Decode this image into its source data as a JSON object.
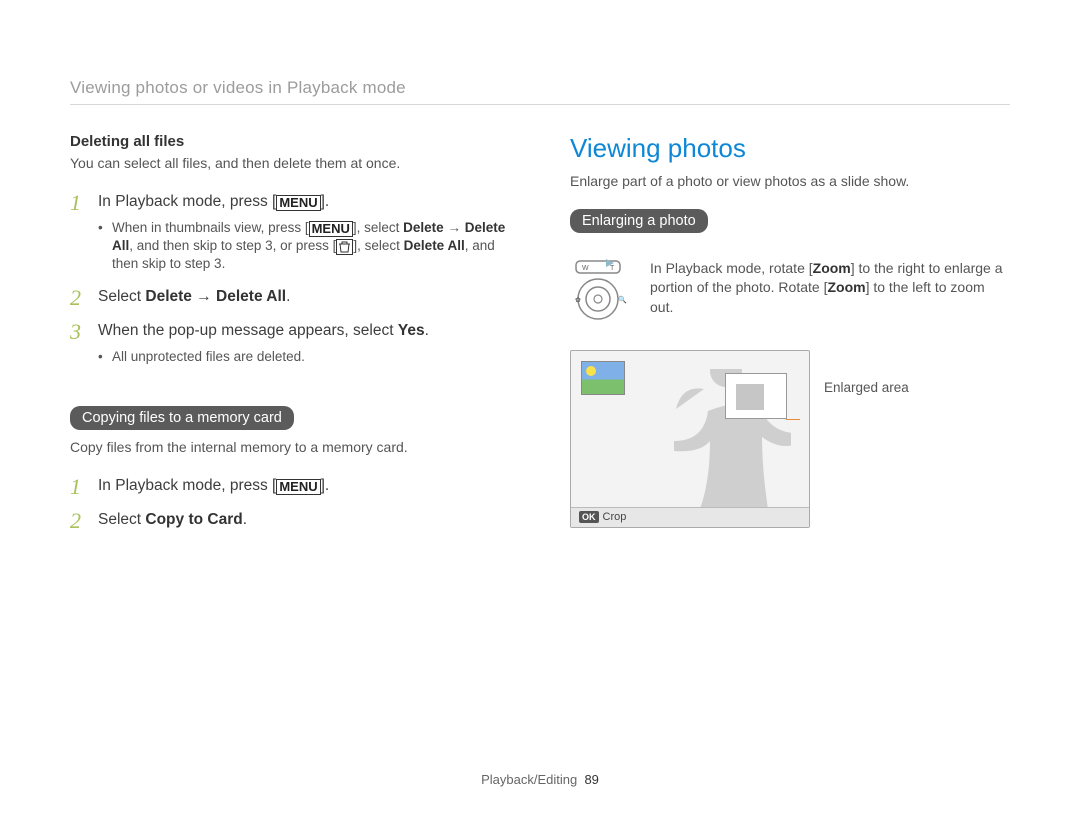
{
  "breadcrumb": "Viewing photos or videos in Playback mode",
  "left": {
    "subheading": "Deleting all files",
    "intro": "You can select all files, and then delete them at once.",
    "steps": [
      {
        "num": "1",
        "text_pre": "In Playback mode, press [",
        "icon": "MENU",
        "text_post": "].",
        "bullets": [
          {
            "pre": "When in thumbnails view, press [",
            "icon1": "MENU",
            "mid": "], select ",
            "b1": "Delete",
            "arrow": " → ",
            "b2": "Delete All",
            "mid2": ", and then skip to step 3, or press [",
            "icon2": "trash",
            "mid3": "], select ",
            "b3": "Delete All",
            "post": ", and then skip to step 3."
          }
        ]
      },
      {
        "num": "2",
        "text_pre": "Select ",
        "b1": "Delete",
        "arrow": " → ",
        "b2": "Delete All",
        "text_post": "."
      },
      {
        "num": "3",
        "text_pre": "When the pop-up message appears, select ",
        "b1": "Yes",
        "text_post": ".",
        "bullets2": "All unprotected files are deleted."
      }
    ],
    "pill": "Copying files to a memory card",
    "pill_desc": "Copy files from the internal memory to a memory card.",
    "steps2": [
      {
        "num": "1",
        "text_pre": "In Playback mode, press [",
        "icon": "MENU",
        "text_post": "]."
      },
      {
        "num": "2",
        "text_pre": "Select ",
        "b1": "Copy to Card",
        "text_post": "."
      }
    ]
  },
  "right": {
    "heading": "Viewing photos",
    "intro": "Enlarge part of a photo or view photos as a slide show.",
    "pill": "Enlarging a photo",
    "zoom_text_pre": "In Playback mode, rotate [",
    "zoom_b1": "Zoom",
    "zoom_text_mid": "] to the right to enlarge a portion of the photo. Rotate [",
    "zoom_b2": "Zoom",
    "zoom_text_post": "] to the left to zoom out.",
    "callout": "Enlarged area",
    "crop_ok": "OK",
    "crop_label": "Crop"
  },
  "footer": {
    "section": "Playback/Editing",
    "page": "89"
  }
}
